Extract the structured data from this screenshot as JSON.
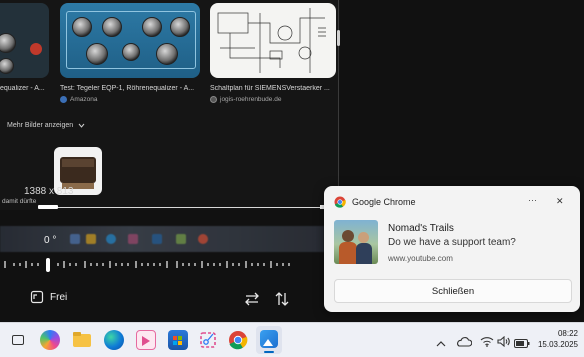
{
  "results": [
    {
      "caption": "equalizer - A...",
      "source": ""
    },
    {
      "caption": "Test: Tegeler EQP-1, Röhrenequalizer - A...",
      "source": "Amazona"
    },
    {
      "caption": "Schaltplan für SIEMENSVerstaerker ...",
      "source": "jogis-roehrenbude.de"
    }
  ],
  "more_images": "Mehr Bilder anzeigen",
  "dimensions": "1388 x 813",
  "partial_caption": "damit dürfte",
  "editor": {
    "rotation": "0 °",
    "free_label": "Frei"
  },
  "notification": {
    "app_name": "Google Chrome",
    "title": "Nomad's Trails",
    "message": "Do we have a support team?",
    "site": "www.youtube.com",
    "close_button": "Schließen",
    "more_label": "···",
    "close_x": "✕"
  },
  "taskbar": {
    "time": "08:22",
    "date": "15.03.2025"
  },
  "colors": {
    "accent_blue": "#0067c0",
    "chrome_red": "#db4437",
    "chrome_yellow": "#f4b400",
    "chrome_green": "#0f9d58"
  }
}
